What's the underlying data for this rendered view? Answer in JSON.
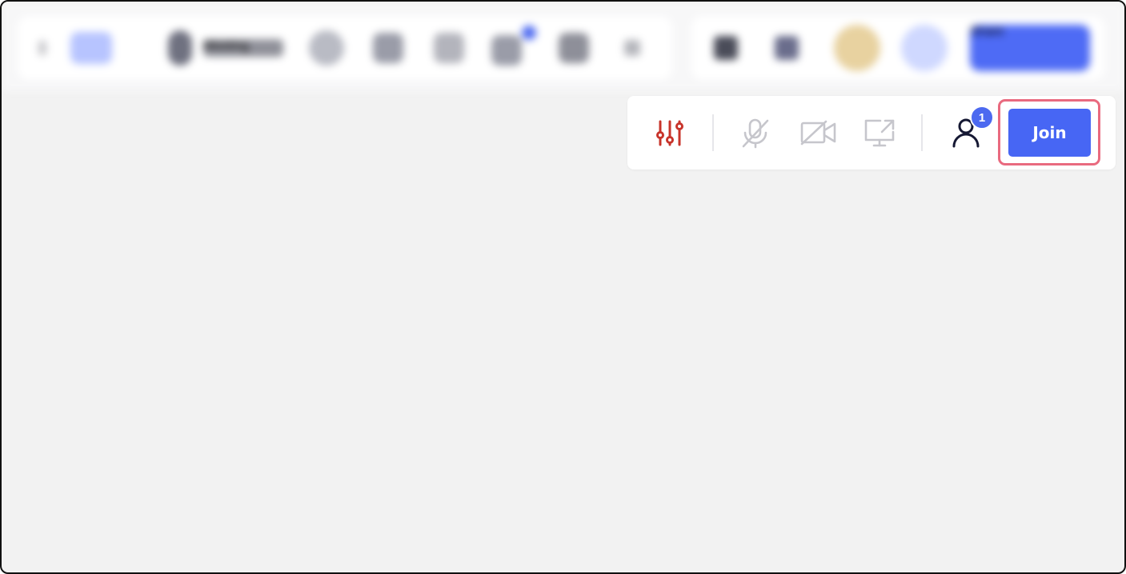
{
  "toolbar": {
    "meeting_label": "Meeting",
    "share_label": "Share"
  },
  "callbar": {
    "settings_icon": "sliders-icon",
    "mic_icon": "mic-off-icon",
    "camera_icon": "video-off-icon",
    "screen_icon": "screen-share-icon",
    "participants_icon": "person-icon",
    "participants_count": "1",
    "join_label": "Join"
  },
  "colors": {
    "accent": "#4766f4",
    "settings_red": "#c8342b",
    "disabled_gray": "#c6c6cc",
    "highlight": "#e96a7f",
    "background": "#f2f2f2"
  }
}
